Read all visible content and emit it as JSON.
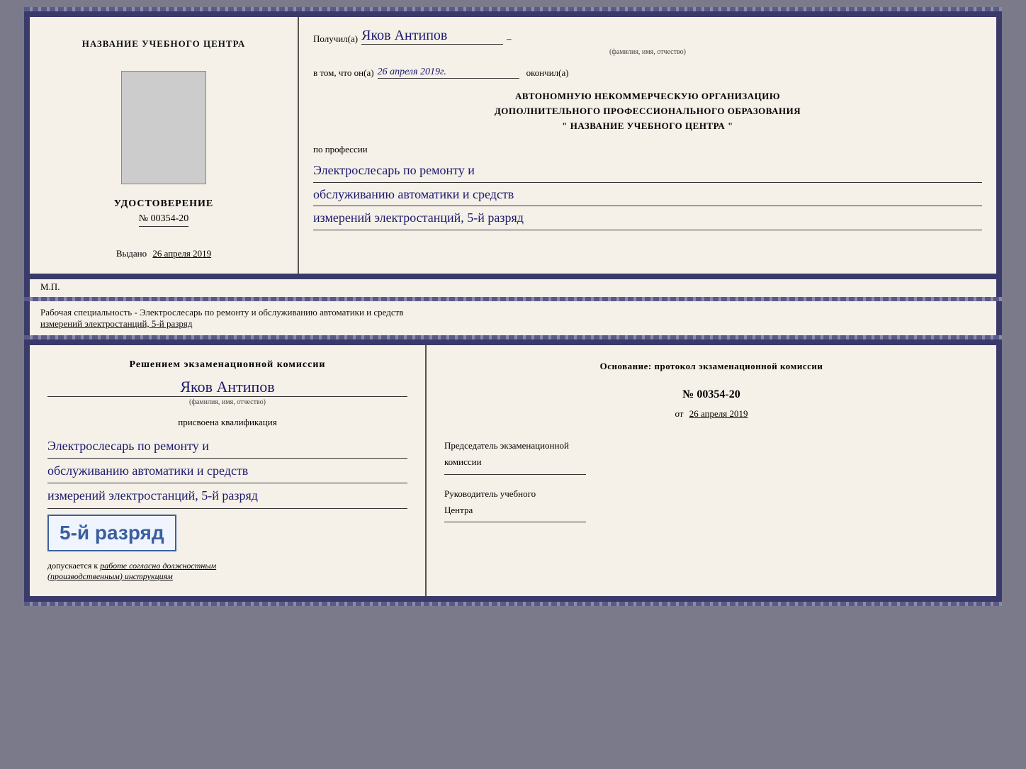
{
  "topDoc": {
    "left": {
      "centerLabel": "НАЗВАНИЕ УЧЕБНОГО ЦЕНТРА",
      "udostoverenie": "УДОСТОВЕРЕНИЕ",
      "number": "№ 00354-20",
      "vydano": "Выдано",
      "vydanoDate": "26 апреля 2019",
      "mp": "М.П."
    },
    "right": {
      "poluchil": "Получил(а)",
      "recipientName": "Яков Антипов",
      "fioLabel": "(фамилия, имя, отчество)",
      "dash": "–",
      "vtom": "в том, что он(а)",
      "date": "26 апреля 2019г.",
      "okonchil": "окончил(а)",
      "orgLine1": "АВТОНОМНУЮ НЕКОММЕРЧЕСКУЮ ОРГАНИЗАЦИЮ",
      "orgLine2": "ДОПОЛНИТЕЛЬНОГО ПРОФЕССИОНАЛЬНОГО ОБРАЗОВАНИЯ",
      "orgLine3": "\" НАЗВАНИЕ УЧЕБНОГО ЦЕНТРА \"",
      "poProfessii": "по профессии",
      "prof1": "Электрослесарь по ремонту и",
      "prof2": "обслуживанию автоматики и средств",
      "prof3": "измерений электростанций, 5-й разряд"
    }
  },
  "middleText": {
    "line1": "Рабочая специальность - Электрослесарь по ремонту и обслуживанию автоматики и средств",
    "line2": "измерений электростанций, 5-й разряд"
  },
  "bottomDoc": {
    "left": {
      "resheniem": "Решением экзаменационной комиссии",
      "fio": "Яков Антипов",
      "fioLabel": "(фамилия, имя, отчество)",
      "prisvoena": "присвоена квалификация",
      "qual1": "Электрослесарь по ремонту и",
      "qual2": "обслуживанию автоматики и средств",
      "qual3": "измерений электростанций, 5-й разряд",
      "razryad": "5-й разряд",
      "dopuskaetsya": "допускается к",
      "workText": "работе согласно должностным",
      "instrText": "(производственным) инструкциям"
    },
    "right": {
      "osnovanie": "Основание: протокол экзаменационной комиссии",
      "protocolNumber": "№ 00354-20",
      "ot": "от",
      "otDate": "26 апреля 2019",
      "predsedatel": "Председатель экзаменационной",
      "komissii": "комиссии",
      "rukovoditel": "Руководитель учебного",
      "tsentra": "Центра"
    }
  }
}
